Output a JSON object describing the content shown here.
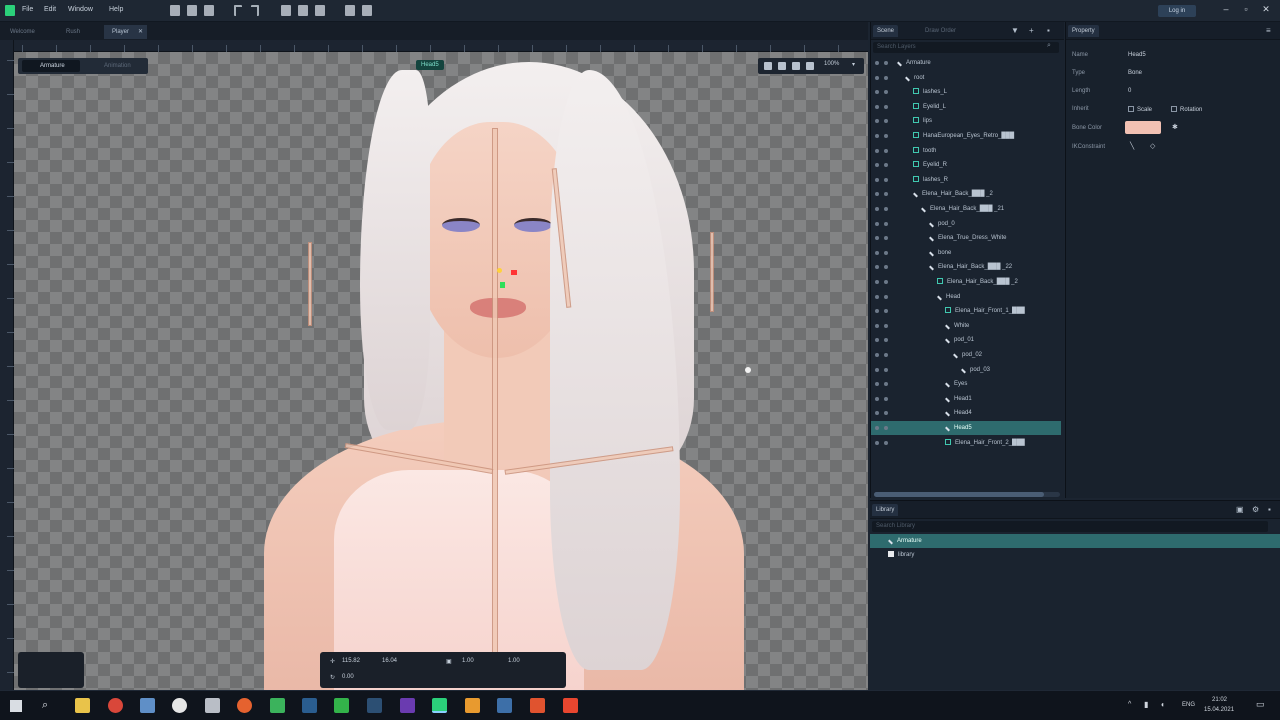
{
  "menu": {
    "file": "File",
    "edit": "Edit",
    "window": "Window",
    "help": "Help"
  },
  "login": "Log in",
  "doc_tabs": [
    "Welcome",
    "Rush",
    "Player"
  ],
  "canvas": {
    "armature_tab": "Armature",
    "animation_tab": "Animation",
    "bone_label": "Head5",
    "zoom": "100%"
  },
  "transform": {
    "x": "115.82",
    "y": "16.04",
    "rotation": "0.00",
    "scale_x": "1.00",
    "scale_y": "1.00"
  },
  "scene": {
    "tab": "Scene",
    "tab2": "Draw Order",
    "search": "Search Layers",
    "rows": [
      {
        "label": "Armature",
        "type": "root",
        "indent": 0
      },
      {
        "label": "root",
        "type": "bone",
        "indent": 1
      },
      {
        "label": "lashes_L",
        "type": "slot",
        "indent": 2
      },
      {
        "label": "Eyelid_L",
        "type": "slot",
        "indent": 2
      },
      {
        "label": "lips",
        "type": "slot",
        "indent": 2
      },
      {
        "label": "HanaEuropean_Eyes_Retro_███",
        "type": "slot",
        "indent": 2
      },
      {
        "label": "tooth",
        "type": "slot",
        "indent": 2
      },
      {
        "label": "Eyelid_R",
        "type": "slot",
        "indent": 2
      },
      {
        "label": "lashes_R",
        "type": "slot",
        "indent": 2
      },
      {
        "label": "Elena_Hair_Back_███ _2",
        "type": "bone",
        "indent": 2
      },
      {
        "label": "Elena_Hair_Back_███ _21",
        "type": "bone",
        "indent": 3
      },
      {
        "label": "pod_0",
        "type": "bone",
        "indent": 4
      },
      {
        "label": "Elena_True_Dress_White",
        "type": "bone",
        "indent": 4
      },
      {
        "label": "bone",
        "type": "bone",
        "indent": 4
      },
      {
        "label": "Elena_Hair_Back_███ _22",
        "type": "bone",
        "indent": 4
      },
      {
        "label": "Elena_Hair_Back_███ _2",
        "type": "slot",
        "indent": 5
      },
      {
        "label": "Head",
        "type": "bone",
        "indent": 5
      },
      {
        "label": "Elena_Hair_Front_1_███",
        "type": "slot",
        "indent": 6
      },
      {
        "label": "White",
        "type": "bone",
        "indent": 6
      },
      {
        "label": "pod_01",
        "type": "bone",
        "indent": 6
      },
      {
        "label": "pod_02",
        "type": "bone",
        "indent": 7
      },
      {
        "label": "pod_03",
        "type": "bone",
        "indent": 8
      },
      {
        "label": "Eyes",
        "type": "bone",
        "indent": 6
      },
      {
        "label": "Head1",
        "type": "bone",
        "indent": 6
      },
      {
        "label": "Head4",
        "type": "bone",
        "indent": 6
      },
      {
        "label": "Head5",
        "type": "bone",
        "indent": 6,
        "selected": true
      },
      {
        "label": "Elena_Hair_Front_2_███",
        "type": "slot",
        "indent": 6
      }
    ]
  },
  "property": {
    "tab": "Property",
    "name_label": "Name",
    "name_value": "Head5",
    "type_label": "Type",
    "type_value": "Bone",
    "length_label": "Length",
    "length_value": "0",
    "inherit_label": "Inherit",
    "scale": "Scale",
    "rotation": "Rotation",
    "bone_color_label": "Bone Color",
    "bone_color": "#f2c1b3",
    "ik_label": "IKConstraint"
  },
  "library": {
    "tab": "Library",
    "search": "Search Library",
    "items": [
      "Armature",
      "library"
    ]
  },
  "taskbar": {
    "lang": "ENG",
    "time": "21:02",
    "date": "15.04.2021"
  }
}
